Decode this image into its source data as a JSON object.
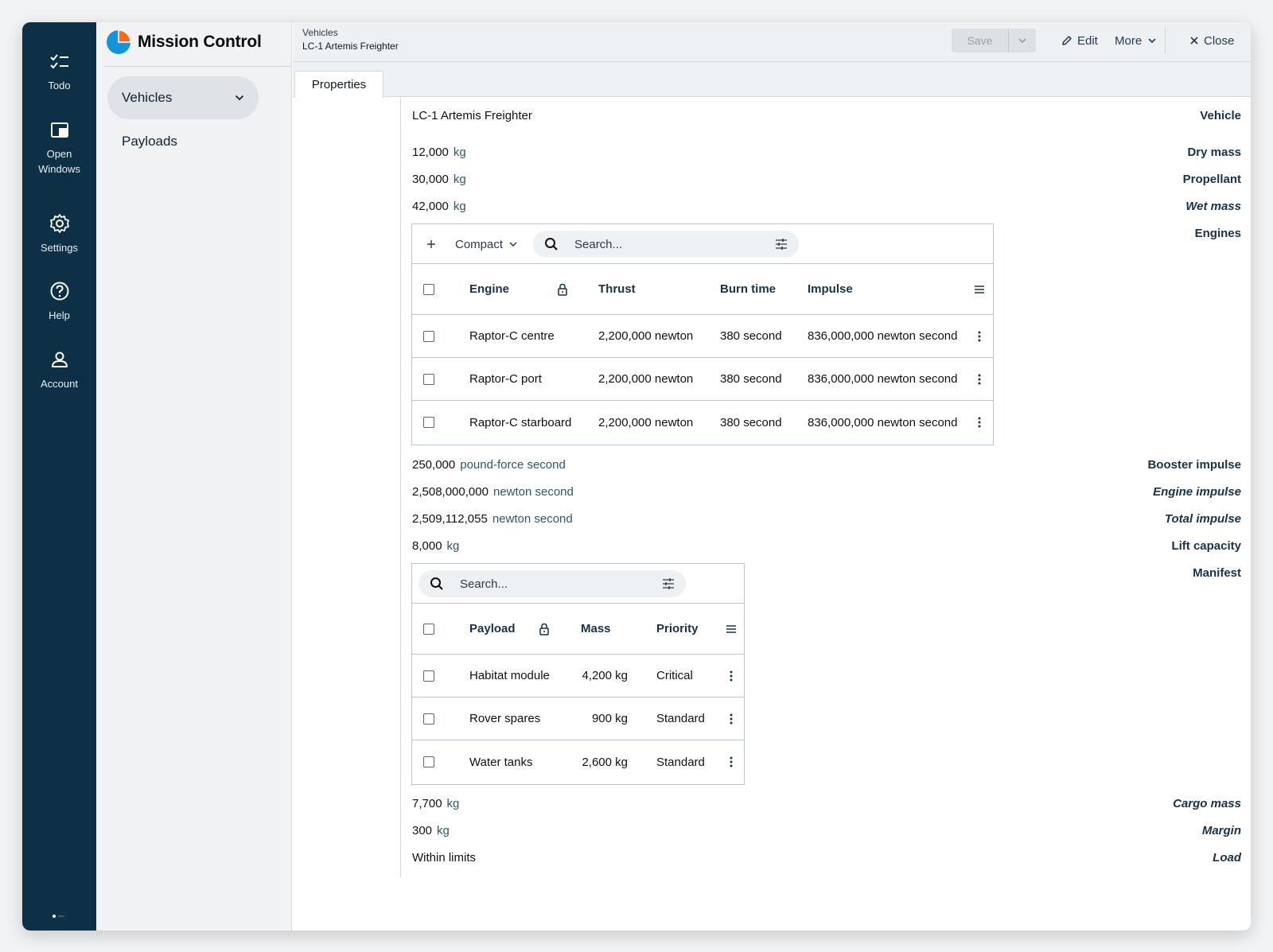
{
  "rail": {
    "items": [
      {
        "label": "Todo",
        "icon": "todo-list-icon"
      },
      {
        "label": "Open Windows",
        "icon": "windows-icon"
      },
      {
        "label": "Settings",
        "icon": "gear-icon"
      },
      {
        "label": "Help",
        "icon": "help-circle-icon"
      },
      {
        "label": "Account",
        "icon": "person-icon"
      }
    ]
  },
  "sidebar": {
    "app_title": "Mission Control",
    "items": [
      {
        "label": "Vehicles"
      },
      {
        "label": "Payloads"
      }
    ]
  },
  "header": {
    "breadcrumb_parent": "Vehicles",
    "breadcrumb_current": "LC-1 Artemis Freighter",
    "save_label": "Save",
    "edit_label": "Edit",
    "more_label": "More",
    "close_label": "Close"
  },
  "tabs": [
    {
      "label": "Properties"
    }
  ],
  "fields": {
    "vehicle": {
      "label": "Vehicle",
      "value": "LC-1 Artemis Freighter"
    },
    "dry_mass": {
      "label": "Dry mass",
      "value": "12,000",
      "unit": "kg"
    },
    "propellant": {
      "label": "Propellant",
      "value": "30,000",
      "unit": "kg"
    },
    "wet_mass": {
      "label": "Wet mass",
      "value": "42,000",
      "unit": "kg"
    },
    "engines": {
      "label": "Engines"
    },
    "booster_impulse": {
      "label": "Booster impulse",
      "value": "250,000",
      "unit": "pound-force second"
    },
    "engine_impulse": {
      "label": "Engine impulse",
      "value": "2,508,000,000",
      "unit": "newton second"
    },
    "total_impulse": {
      "label": "Total impulse",
      "value": "2,509,112,055",
      "unit": "newton second"
    },
    "lift_capacity": {
      "label": "Lift capacity",
      "value": "8,000",
      "unit": "kg"
    },
    "manifest": {
      "label": "Manifest"
    },
    "cargo_mass": {
      "label": "Cargo mass",
      "value": "7,700",
      "unit": "kg"
    },
    "margin": {
      "label": "Margin",
      "value": "300",
      "unit": "kg"
    },
    "load": {
      "label": "Load",
      "value": "Within limits"
    }
  },
  "engines_table": {
    "view_label": "Compact",
    "search_placeholder": "Search...",
    "columns": {
      "engine": "Engine",
      "thrust": "Thrust",
      "burn_time": "Burn time",
      "impulse": "Impulse"
    },
    "rows": [
      {
        "engine": "Raptor-C centre",
        "thrust": "2,200,000 newton",
        "burn_time": "380 second",
        "impulse": "836,000,000 newton second"
      },
      {
        "engine": "Raptor-C port",
        "thrust": "2,200,000 newton",
        "burn_time": "380 second",
        "impulse": "836,000,000 newton second"
      },
      {
        "engine": "Raptor-C starboard",
        "thrust": "2,200,000 newton",
        "burn_time": "380 second",
        "impulse": "836,000,000 newton second"
      }
    ]
  },
  "manifest_table": {
    "search_placeholder": "Search...",
    "columns": {
      "payload": "Payload",
      "mass": "Mass",
      "priority": "Priority"
    },
    "rows": [
      {
        "payload": "Habitat module",
        "mass": "4,200 kg",
        "priority": "Critical"
      },
      {
        "payload": "Rover spares",
        "mass": "900 kg",
        "priority": "Standard"
      },
      {
        "payload": "Water tanks",
        "mass": "2,600 kg",
        "priority": "Standard"
      }
    ]
  },
  "colors": {
    "rail_bg": "#0e3047",
    "label_text": "#17324a",
    "brand_blue": "#1793d8",
    "brand_orange": "#f26b21"
  }
}
